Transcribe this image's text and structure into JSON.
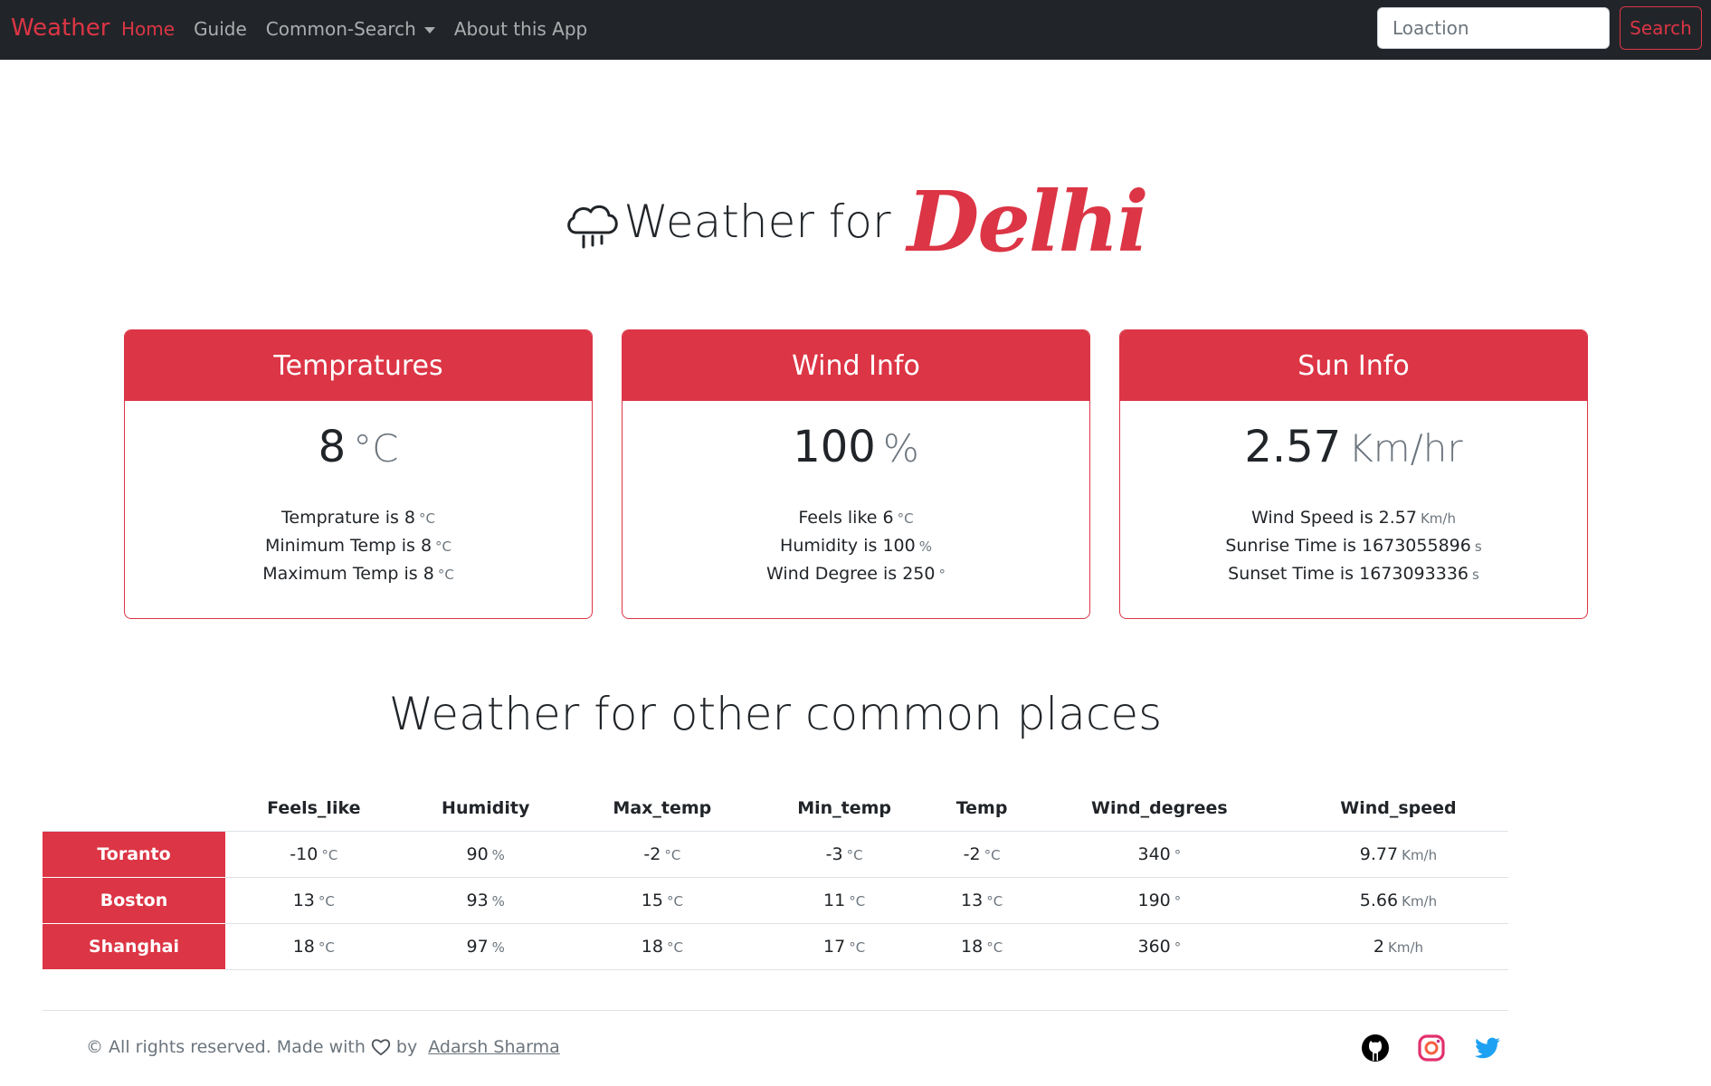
{
  "nav": {
    "brand": "Weather",
    "links": [
      {
        "label": "Home"
      },
      {
        "label": "Guide"
      },
      {
        "label": "Common-Search"
      },
      {
        "label": "About this App"
      }
    ],
    "search_placeholder": "Loaction",
    "search_button": "Search"
  },
  "hero": {
    "icon": "cloud-rain-icon",
    "prefix": "Weather for",
    "city": "Delhi"
  },
  "cards": [
    {
      "title": "Tempratures",
      "big_value": "8",
      "big_unit": "°C",
      "lines": [
        {
          "text": "Temprature is 8",
          "unit": "°C"
        },
        {
          "text": "Minimum Temp is 8",
          "unit": "°C"
        },
        {
          "text": "Maximum Temp is 8",
          "unit": "°C"
        }
      ]
    },
    {
      "title": "Wind Info",
      "big_value": "100",
      "big_unit": "%",
      "lines": [
        {
          "text": "Feels like 6",
          "unit": "°C"
        },
        {
          "text": "Humidity is 100",
          "unit": "%"
        },
        {
          "text": "Wind Degree is 250",
          "unit": "°"
        }
      ]
    },
    {
      "title": "Sun Info",
      "big_value": "2.57",
      "big_unit": "Km/hr",
      "lines": [
        {
          "text": "Wind Speed is 2.57",
          "unit": "Km/h"
        },
        {
          "text": "Sunrise Time is 1673055896",
          "unit": "s"
        },
        {
          "text": "Sunset Time is 1673093336",
          "unit": "s"
        }
      ]
    }
  ],
  "common_title": "Weather for other common places",
  "table": {
    "headers": [
      "",
      "Feels_like",
      "Humidity",
      "Max_temp",
      "Min_temp",
      "Temp",
      "Wind_degrees",
      "Wind_speed"
    ],
    "rows": [
      {
        "city": "Toranto",
        "cells": [
          {
            "v": "-10",
            "u": "°C"
          },
          {
            "v": "90",
            "u": "%"
          },
          {
            "v": "-2",
            "u": "°C"
          },
          {
            "v": "-3",
            "u": "°C"
          },
          {
            "v": "-2",
            "u": "°C"
          },
          {
            "v": "340",
            "u": "°"
          },
          {
            "v": "9.77",
            "u": "Km/h"
          }
        ]
      },
      {
        "city": "Boston",
        "cells": [
          {
            "v": "13",
            "u": "°C"
          },
          {
            "v": "93",
            "u": "%"
          },
          {
            "v": "15",
            "u": "°C"
          },
          {
            "v": "11",
            "u": "°C"
          },
          {
            "v": "13",
            "u": "°C"
          },
          {
            "v": "190",
            "u": "°"
          },
          {
            "v": "5.66",
            "u": "Km/h"
          }
        ]
      },
      {
        "city": "Shanghai",
        "cells": [
          {
            "v": "18",
            "u": "°C"
          },
          {
            "v": "97",
            "u": "%"
          },
          {
            "v": "18",
            "u": "°C"
          },
          {
            "v": "17",
            "u": "°C"
          },
          {
            "v": "18",
            "u": "°C"
          },
          {
            "v": "360",
            "u": "°"
          },
          {
            "v": "2",
            "u": "Km/h"
          }
        ]
      }
    ]
  },
  "footer": {
    "text_before": "© All rights reserved. Made with",
    "heart_icon": "heart-icon",
    "text_by": "by",
    "author": "Adarsh Sharma",
    "social": [
      {
        "icon": "github-icon",
        "color": "#000000"
      },
      {
        "icon": "instagram-icon",
        "color": "#e1306c"
      },
      {
        "icon": "twitter-icon",
        "color": "#1da1f2"
      }
    ]
  },
  "colors": {
    "accent": "#dc3545",
    "navbar": "#212529",
    "muted": "#6c757d"
  }
}
